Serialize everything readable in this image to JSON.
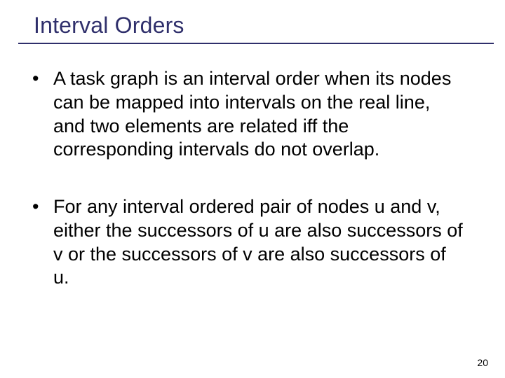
{
  "slide": {
    "title": "Interval Orders",
    "bullets": [
      "A task graph is an interval order when its nodes can be mapped into intervals on the real line, and two elements are related iff the corresponding intervals do not overlap.",
      "For any interval ordered pair of nodes u and v, either the successors of u are also successors of v or the successors of v are also successors of u."
    ],
    "page_number": "20"
  }
}
